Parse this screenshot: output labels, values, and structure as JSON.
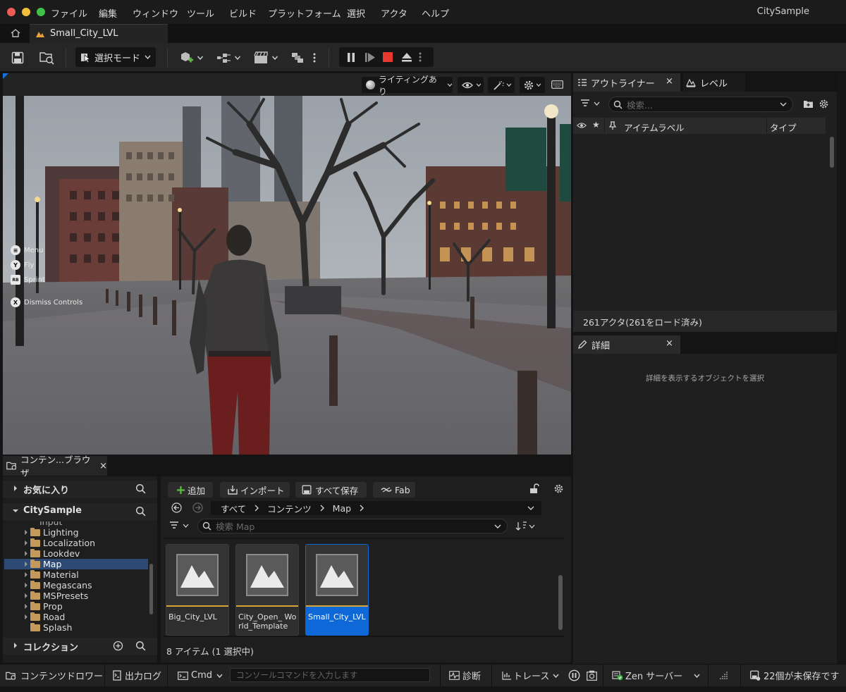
{
  "menu": {
    "items": [
      "ファイル",
      "編集",
      "ウィンドウ",
      "ツール",
      "ビルド",
      "プラットフォーム",
      "選択",
      "アクタ",
      "ヘルプ"
    ],
    "project_name": "CitySample"
  },
  "tabs": {
    "map_tab_label": "Small_City_LVL"
  },
  "toolbar": {
    "mode_label": "選択モード"
  },
  "viewport": {
    "lighting_label": "ライティングあり",
    "controls": {
      "menu": {
        "key": "≡",
        "label": "Menu"
      },
      "fly": {
        "key": "Y",
        "label": "Fly"
      },
      "sprint": {
        "key": "RB",
        "label": "Sprint"
      },
      "dismiss": {
        "key": "X",
        "label": "Dismiss Controls"
      }
    }
  },
  "outliner": {
    "tab_label": "アウトライナー",
    "level_tab_label": "レベル",
    "search_placeholder": "検索...",
    "col_item_label": "アイテムラベル",
    "col_type": "タイプ",
    "status": "261アクタ(261をロード済み)"
  },
  "details": {
    "tab_label": "詳細",
    "empty_message": "詳細を表示するオブジェクトを選択"
  },
  "content_browser": {
    "tab_label": "コンテン...ブラウザ",
    "favorites_label": "お気に入り",
    "root_label": "CitySample",
    "collections_label": "コレクション",
    "partial_folder": "Input",
    "folders": [
      "Lighting",
      "Localization",
      "Lookdev",
      "Map",
      "Material",
      "Megascans",
      "MSPresets",
      "Prop",
      "Road",
      "Splash"
    ],
    "selected_folder": "Map",
    "add_label": "追加",
    "import_label": "インポート",
    "save_all_label": "すべて保存",
    "fab_label": "Fab",
    "breadcrumb": [
      "すべて",
      "コンテンツ",
      "Map"
    ],
    "search_placeholder": "検索 Map",
    "assets": [
      {
        "name": "Big_City_LVL",
        "selected": false
      },
      {
        "name": "City_Open_ World_Template",
        "selected": false
      },
      {
        "name": "Small_City_LVL",
        "selected": true
      }
    ],
    "item_count": "8 アイテム (1 選択中)"
  },
  "statusbar": {
    "content_drawer": "コンテンツドロワー",
    "output_log": "出力ログ",
    "cmd_label": "Cmd",
    "console_placeholder": "コンソールコマンドを入力します",
    "diagnostics": "診断",
    "trace": "トレース",
    "zen_server": "Zen サーバー",
    "unsaved": "22個が未保存です"
  },
  "colors": {
    "accent_blue": "#0e68d8",
    "play_stop_red": "#e8382f",
    "folder": "#c39a5c",
    "asset_bar": "#d7a539"
  }
}
